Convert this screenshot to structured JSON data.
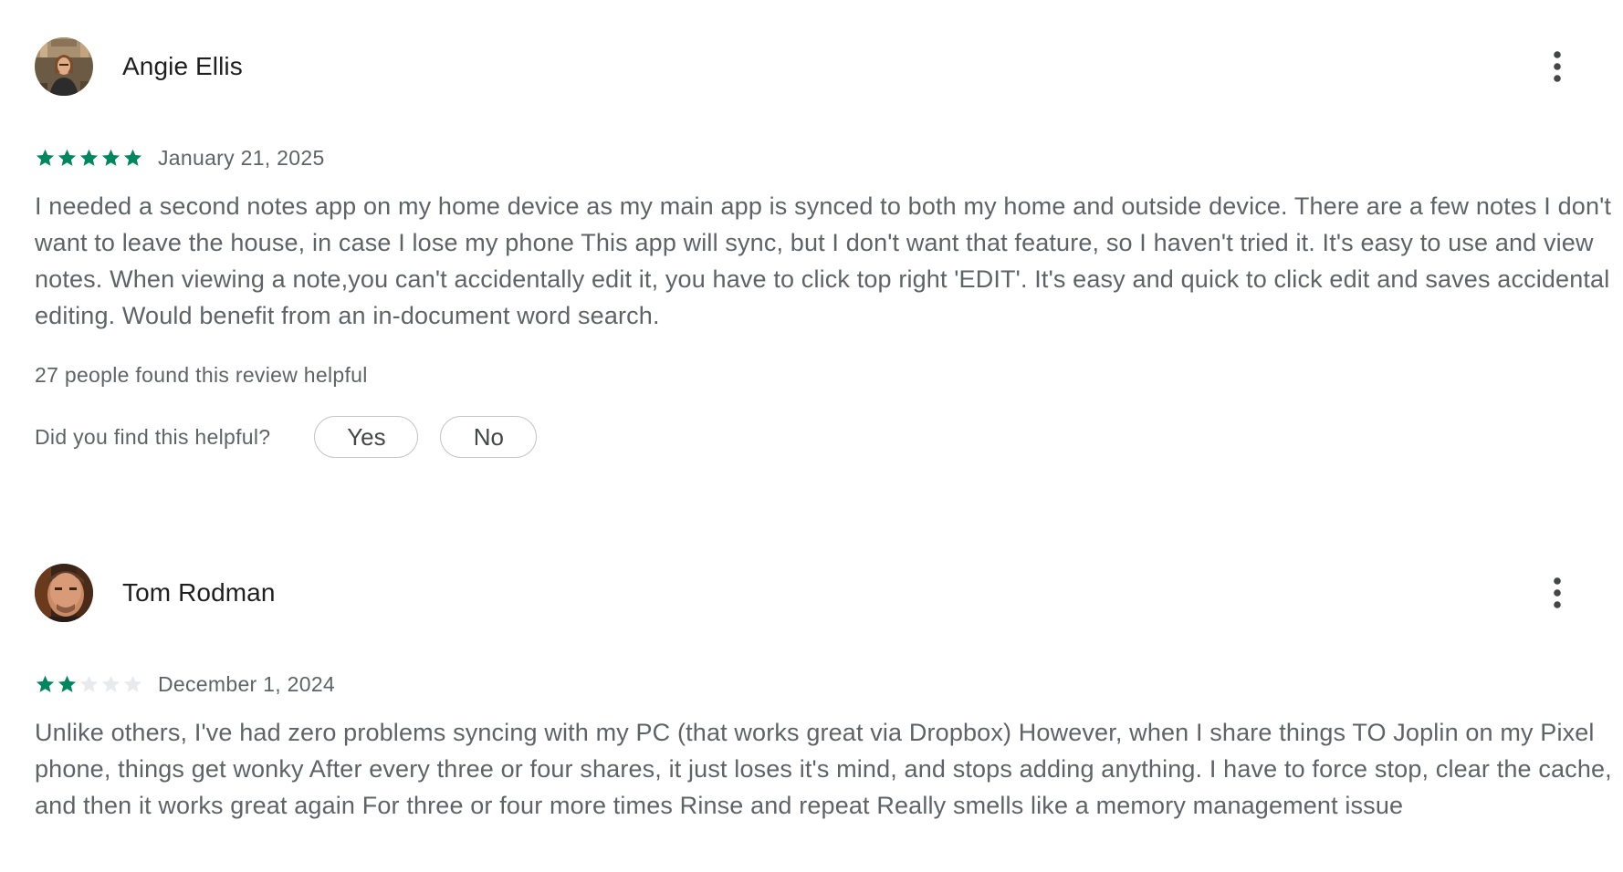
{
  "reviews": [
    {
      "reviewer_name": "Angie Ellis",
      "avatar_icon": "photo-avatar",
      "rating": 5,
      "rating_max": 5,
      "date": "January 21, 2025",
      "text": "I needed a second notes app on my home device as my main app is synced to both my home and outside device. There are a few notes I don't want to leave the house, in case I lose my phone This app will sync, but I don't want that feature, so I haven't tried it. It's easy to use and view notes. When viewing a note,you can't accidentally edit it, you have to click top right 'EDIT'. It's easy and quick to click edit and saves accidental editing. Would benefit from an in-document word search.",
      "helpful_count_text": "27 people found this review helpful",
      "helpful_question": "Did you find this helpful?",
      "yes_label": "Yes",
      "no_label": "No",
      "more_icon": "more-vert-icon"
    },
    {
      "reviewer_name": "Tom Rodman",
      "avatar_icon": "photo-avatar",
      "rating": 2,
      "rating_max": 5,
      "date": "December 1, 2024",
      "text": "Unlike others, I've had zero problems syncing with my PC (that works great via Dropbox) However, when I share things TO Joplin on my Pixel phone, things get wonky After every three or four shares, it just loses it's mind, and stops adding anything. I have to force stop, clear the cache, and then it works great again For three or four more times Rinse and repeat Really smells like a memory management issue",
      "more_icon": "more-vert-icon"
    }
  ],
  "colors": {
    "star_filled": "#01875f",
    "star_empty": "#e8eaed",
    "secondary_text": "#5f6368",
    "primary_text": "#1f1f1f"
  }
}
